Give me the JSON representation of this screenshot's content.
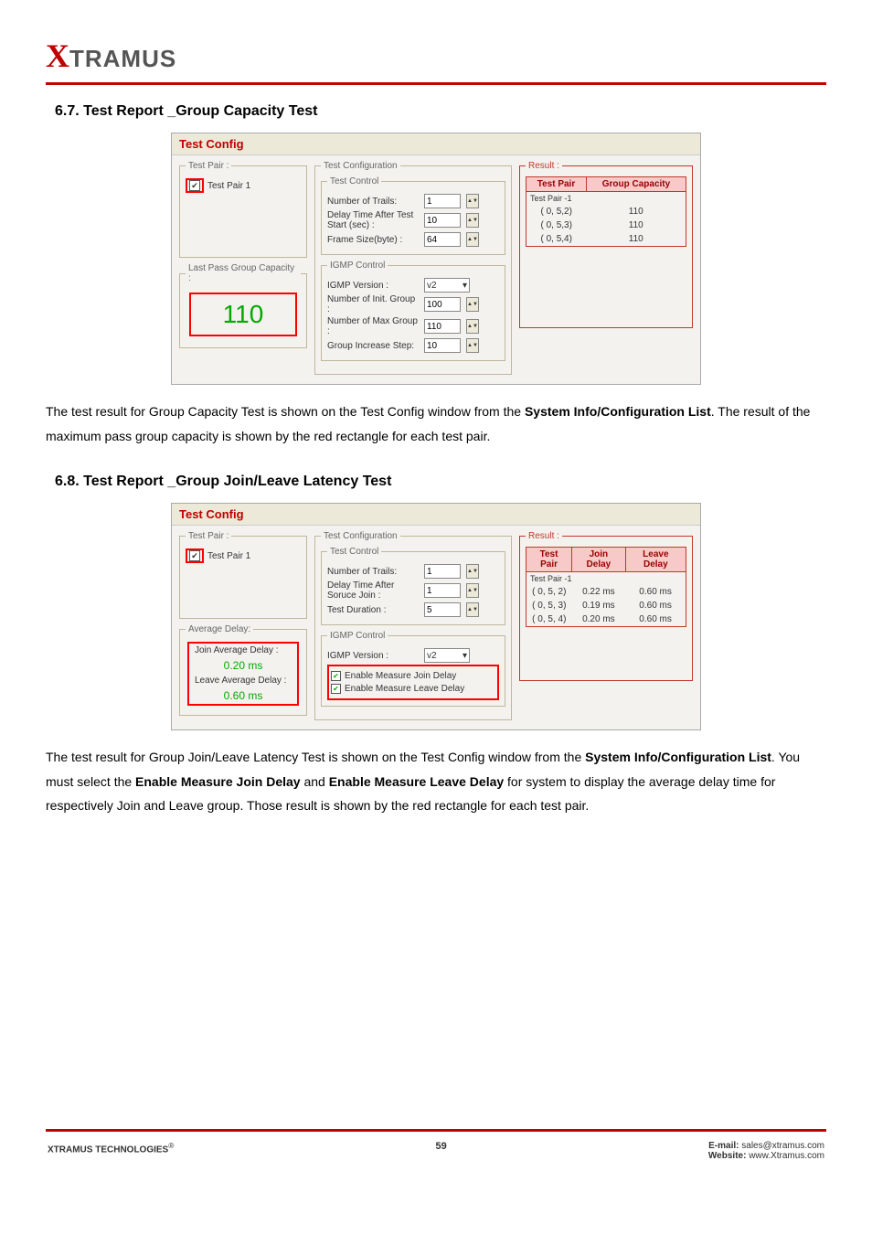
{
  "logo": {
    "x": "X",
    "rest": "TRAMUS"
  },
  "section67": {
    "heading": "6.7. Test Report _Group Capacity Test",
    "body_prefix": "The test result for Group Capacity Test is shown on the Test Config window from the ",
    "body_bold1": "System Info/Configuration List",
    "body_suffix": ". The result of the maximum pass group capacity is shown by the red rectangle for each test pair."
  },
  "screenshot1": {
    "title": "Test Config",
    "test_pair_legend": "Test Pair :",
    "test_pair1_label": "Test Pair 1",
    "last_pass_legend": "Last Pass Group Capacity :",
    "last_pass_value": "110",
    "test_config_legend": "Test Configuration",
    "test_control_legend": "Test Control",
    "numtrails_label": "Number of Trails:",
    "numtrails_val": "1",
    "delay_label": "Delay Time After Test Start (sec)  :",
    "delay_val": "10",
    "framesize_label": "Frame Size(byte) :",
    "framesize_val": "64",
    "igmp_legend": "IGMP Control",
    "igmp_ver_label": "IGMP Version :",
    "igmp_ver_val": "v2",
    "initgroup_label": "Number of Init. Group :",
    "initgroup_val": "100",
    "maxgroup_label": "Number of Max Group :",
    "maxgroup_val": "110",
    "step_label": "Group Increase Step:",
    "step_val": "10",
    "result_legend": "Result :",
    "result_headers": [
      "Test Pair",
      "Group Capacity"
    ],
    "result_sub": "Test Pair -1",
    "result_rows": [
      [
        "(  0, 5,2)",
        "110"
      ],
      [
        "(  0, 5,3)",
        "110"
      ],
      [
        "(  0, 5,4)",
        "110"
      ]
    ]
  },
  "section68": {
    "heading": "6.8. Test Report _Group Join/Leave Latency Test",
    "body_prefix": "The test result for Group Join/Leave Latency Test is shown on the Test Config window from the ",
    "body_bold1": "System Info/Configuration List",
    "body_mid1": ". You must select the ",
    "body_bold2": "Enable Measure Join Delay",
    "body_mid2": " and ",
    "body_bold3": "Enable Measure Leave Delay",
    "body_suffix": " for system to display the average delay time for respectively Join and Leave group. Those result is shown by the red rectangle for each test pair."
  },
  "screenshot2": {
    "title": "Test Config",
    "test_pair_legend": "Test Pair :",
    "test_pair1_label": "Test Pair 1",
    "avg_delay_legend": "Average Delay:",
    "join_avg_label": "Join Average Delay :",
    "join_avg_val": "0.20 ms",
    "leave_avg_label": "Leave Average Delay :",
    "leave_avg_val": "0.60 ms",
    "test_config_legend": "Test Configuration",
    "test_control_legend": "Test Control",
    "numtrails_label": "Number of Trails:",
    "numtrails_val": "1",
    "delay_label": "Delay Time After Soruce Join :",
    "delay_val": "1",
    "testdur_label": "Test Duration :",
    "testdur_val": "5",
    "igmp_legend": "IGMP Control",
    "igmp_ver_label": "IGMP Version :",
    "igmp_ver_val": "v2",
    "enable_join_label": "Enable Measure Join Delay",
    "enable_leave_label": "Enable Measure Leave Delay",
    "result_legend": "Result :",
    "result_headers": [
      "Test Pair",
      "Join Delay",
      "Leave Delay"
    ],
    "result_sub": "Test Pair -1",
    "result_rows": [
      [
        "(  0, 5, 2)",
        "0.22 ms",
        "0.60 ms"
      ],
      [
        "(  0, 5, 3)",
        "0.19 ms",
        "0.60 ms"
      ],
      [
        "(  0, 5, 4)",
        "0.20 ms",
        "0.60 ms"
      ]
    ]
  },
  "footer": {
    "left_brand": "XTRAMUS TECHNOLOGIES",
    "left_r": "®",
    "page_num": "59",
    "email_label": "E-mail: ",
    "email_val": "sales@xtramus.com",
    "web_label": "Website:  ",
    "web_val": "www.Xtramus.com"
  }
}
